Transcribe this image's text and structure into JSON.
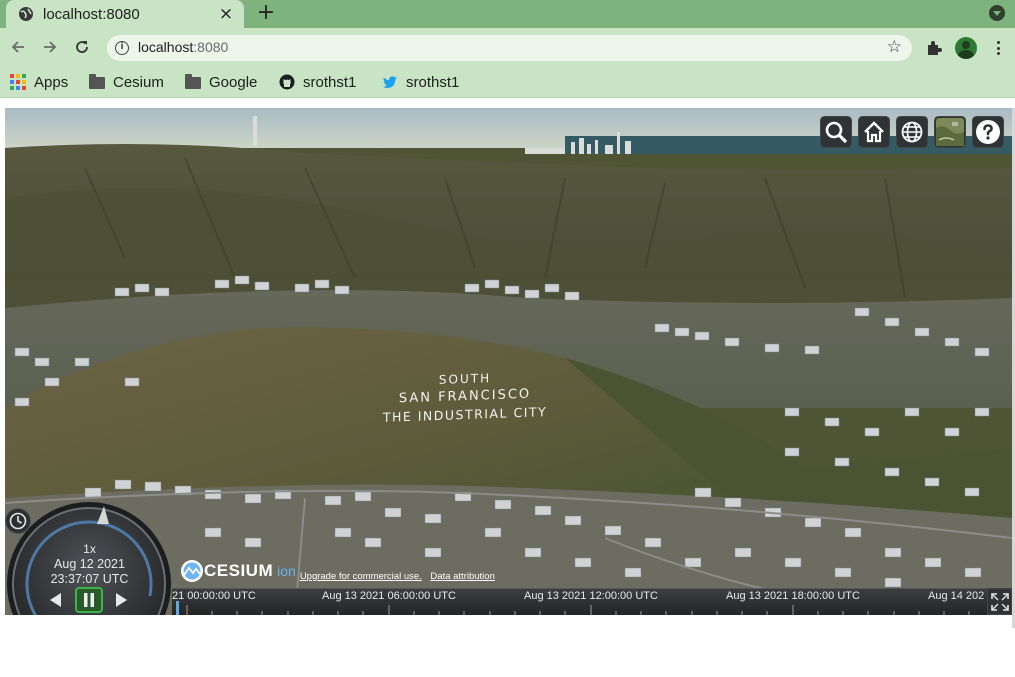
{
  "browser": {
    "tab": {
      "title": "localhost:8080",
      "close_glyph": "×"
    },
    "new_tab_glyph": "+",
    "omnibox": {
      "host": "localhost",
      "port": ":8080"
    },
    "bookmarks": [
      {
        "label": "Apps",
        "icon": "apps-grid-icon"
      },
      {
        "label": "Cesium",
        "icon": "folder-icon"
      },
      {
        "label": "Google",
        "icon": "folder-icon"
      },
      {
        "label": "srothst1",
        "icon": "github-icon"
      },
      {
        "label": "srothst1",
        "icon": "twitter-icon"
      }
    ]
  },
  "colors": {
    "tabbar": "#7fb37e",
    "toolbar": "#c9e4c5",
    "cesium_button": "#303336",
    "timeline_needle": "#5ca9e8"
  },
  "viewer": {
    "hillside_text": [
      "SOUTH",
      "SAN FRANCISCO",
      "THE INDUSTRIAL CITY"
    ],
    "toolbar_buttons": [
      "search-icon",
      "home-icon",
      "globe-icon",
      "imagery-layer-icon",
      "help-icon"
    ],
    "animation": {
      "speed": "1x",
      "date": "Aug 12 2021",
      "time": "23:37:07 UTC",
      "state": "playing"
    },
    "credits": {
      "logo": "CESIUM",
      "logo_suffix": "ion",
      "links": [
        "Upgrade for commercial use.",
        "Data attribution"
      ]
    },
    "timeline": {
      "labels": [
        "21 00:00:00 UTC",
        "Aug 13 2021 06:00:00 UTC",
        "Aug 13 2021 12:00:00 UTC",
        "Aug 13 2021 18:00:00 UTC",
        "Aug 14 202"
      ]
    }
  }
}
